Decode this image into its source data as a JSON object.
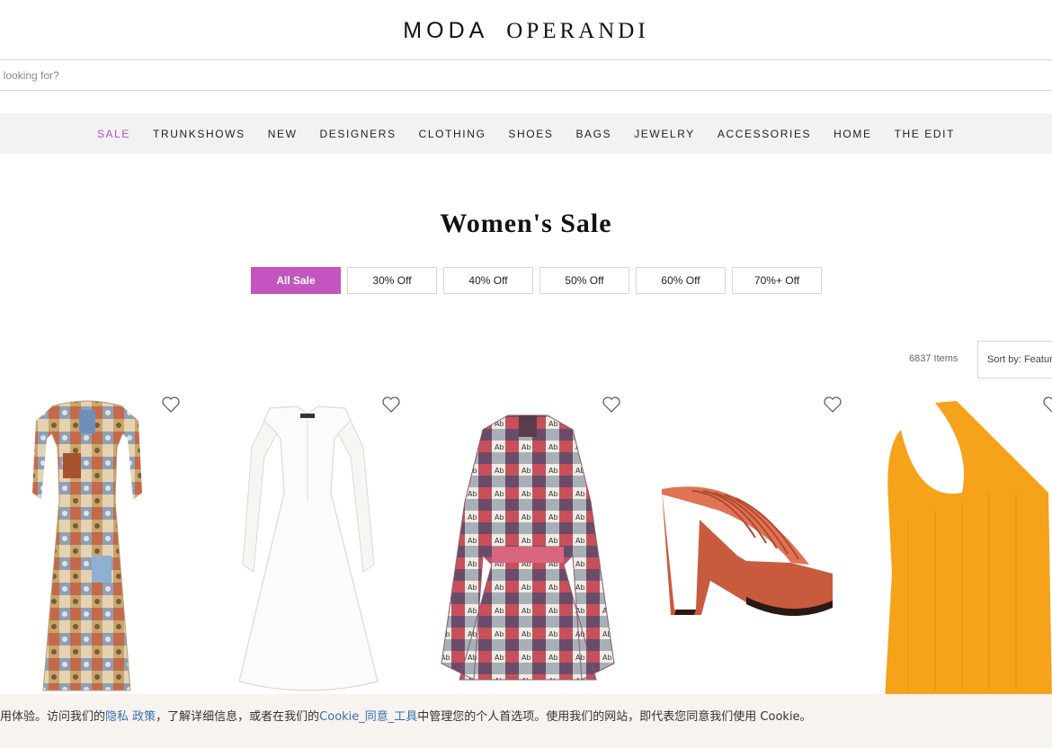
{
  "brand": {
    "word1": "MODA",
    "word2": "OPERANDI"
  },
  "search": {
    "placeholder": "you looking for?"
  },
  "nav": {
    "items": [
      {
        "label": "SALE",
        "active": true
      },
      {
        "label": "TRUNKSHOWS"
      },
      {
        "label": "NEW"
      },
      {
        "label": "DESIGNERS"
      },
      {
        "label": "CLOTHING"
      },
      {
        "label": "SHOES"
      },
      {
        "label": "BAGS"
      },
      {
        "label": "JEWELRY"
      },
      {
        "label": "ACCESSORIES"
      },
      {
        "label": "HOME"
      },
      {
        "label": "THE EDIT"
      }
    ],
    "active_color": "#b94fb4"
  },
  "page": {
    "title": "Women's Sale"
  },
  "filters": [
    {
      "label": "All Sale",
      "active": true
    },
    {
      "label": "30% Off"
    },
    {
      "label": "40% Off"
    },
    {
      "label": "50% Off"
    },
    {
      "label": "60% Off"
    },
    {
      "label": "70%+ Off"
    }
  ],
  "accent_color": "#c355bf",
  "results": {
    "count": "6837 Items",
    "sort_label": "Sort by: Featured"
  },
  "products": [
    {
      "image": "patchwork-print-maxi-dress",
      "icon": "heart-icon"
    },
    {
      "image": "white-off-shoulder-shirt-dress",
      "icon": "heart-icon"
    },
    {
      "image": "printed-silk-mini-dress",
      "icon": "heart-icon"
    },
    {
      "image": "orange-platform-sandal",
      "icon": "heart-icon"
    },
    {
      "image": "orange-one-shoulder-top",
      "icon": "heart-icon"
    }
  ],
  "cookie": {
    "text1": "用体验。访问我们的",
    "link1": "隐私 政策",
    "text2": "，了解详细信息，或者在我们的",
    "link2": "Cookie_同意_工具",
    "text3": "中管理您的个人首选项。使用我们的网站，即代表您同意我们使用 Cookie。"
  }
}
